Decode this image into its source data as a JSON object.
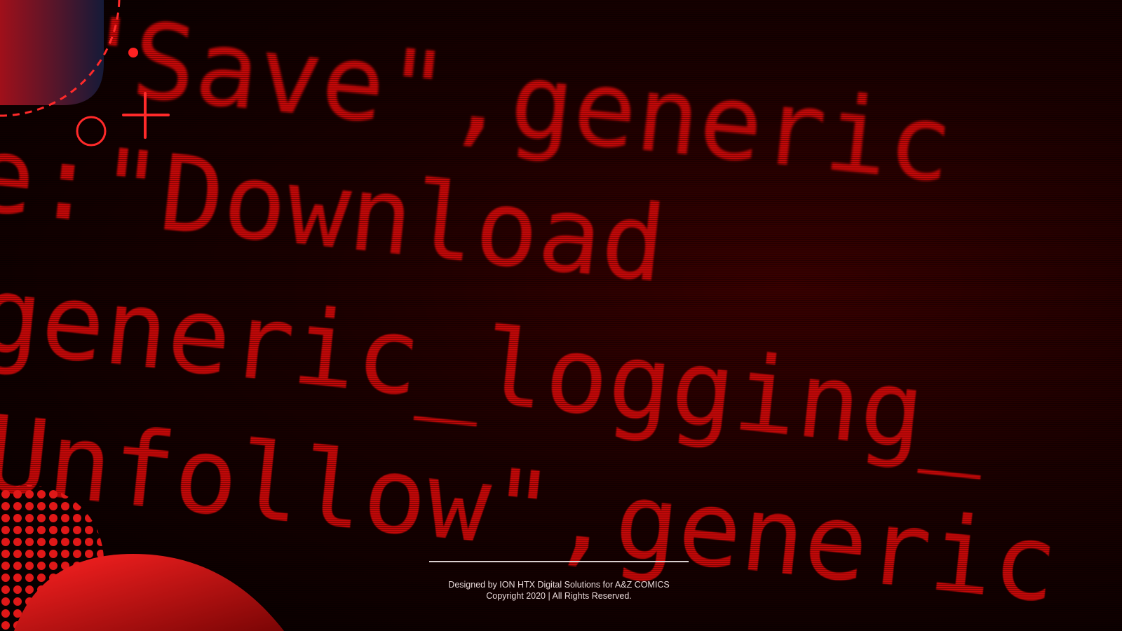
{
  "background_code": {
    "line1": ":\"Save\",generic",
    "line2": "e:\"Download",
    "line3": "generic_logging_",
    "line4": "Unfollow\",generic"
  },
  "footer": {
    "credit": "Designed by ION HTX Digital Solutions for A&Z COMICS",
    "copyright": "Copyright 2020 | All Rights Reserved."
  },
  "colors": {
    "accent": "#ff1a1a",
    "background": "#0a0000",
    "code_text": "#c40808"
  }
}
